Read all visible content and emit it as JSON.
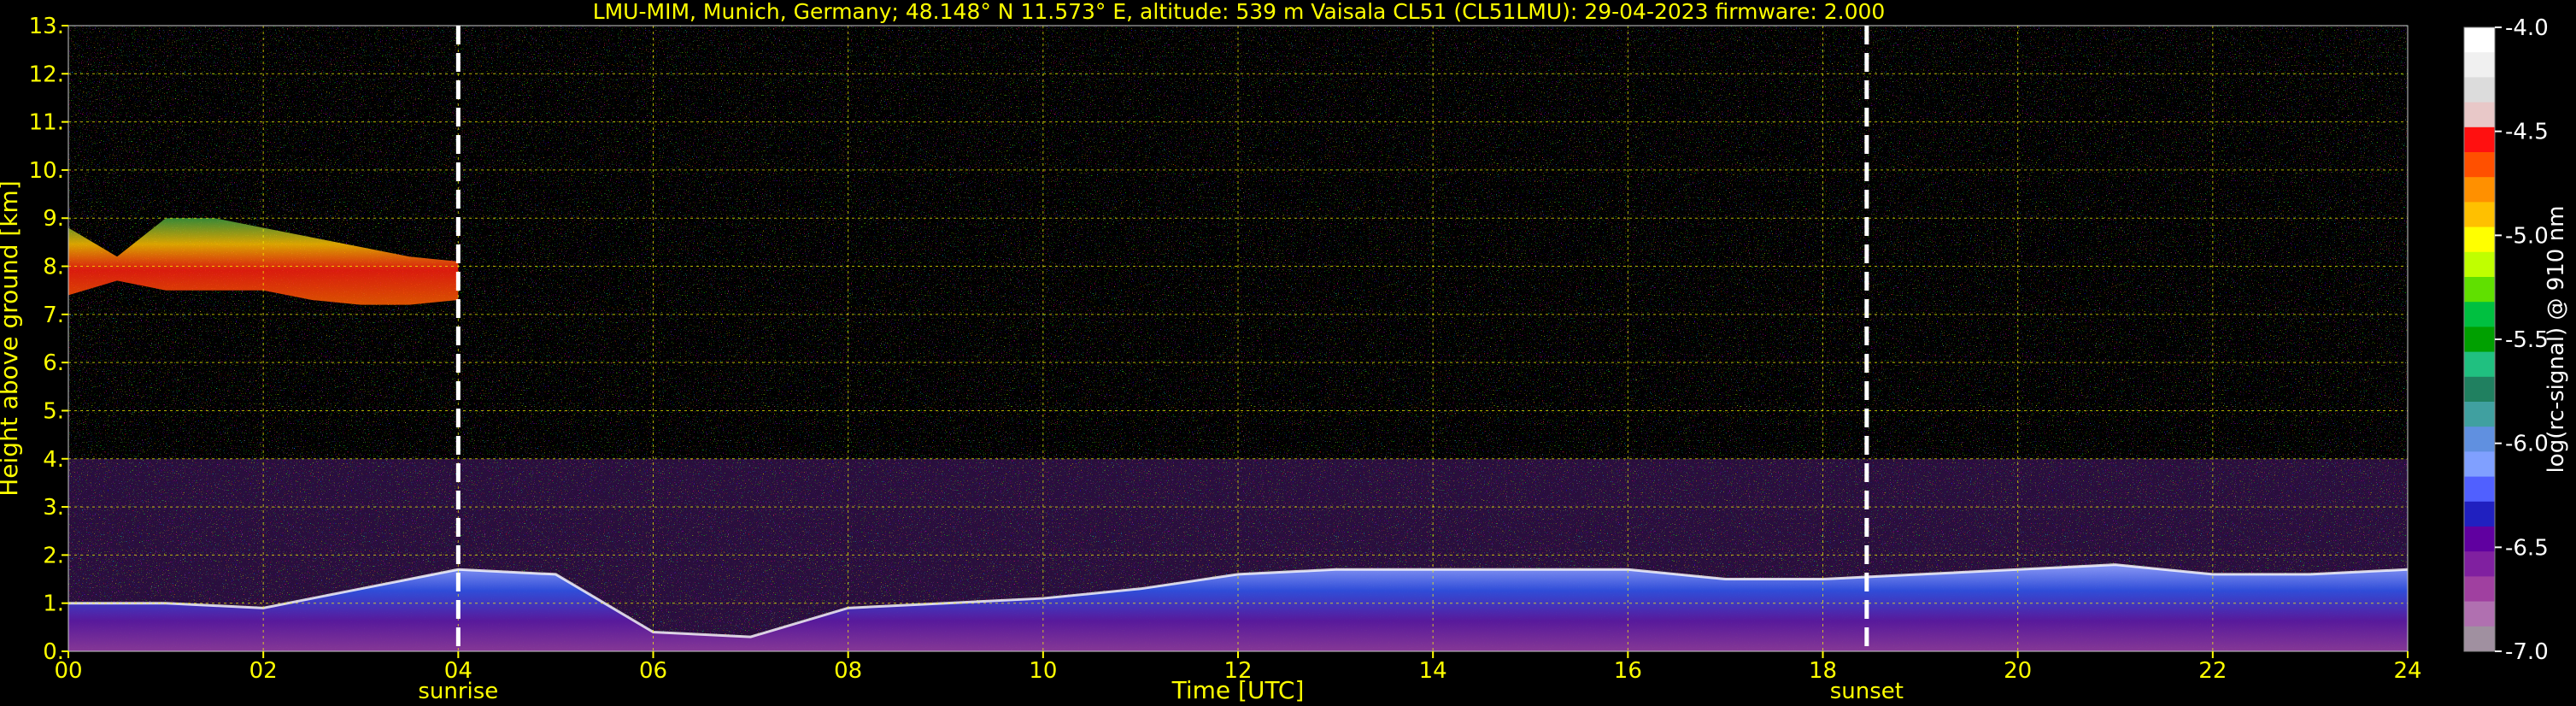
{
  "chart_data": {
    "type": "heatmap",
    "title": "LMU-MIM, Munich, Germany; 48.148° N 11.573° E, altitude: 539 m    Vaisala CL51 (CL51LMU): 29-04-2023    firmware: 2.000",
    "xlabel": "Time [UTC]",
    "ylabel": "Height above ground [km]",
    "xlim": [
      0,
      24
    ],
    "ylim": [
      0,
      13
    ],
    "x_ticks": [
      "00",
      "02",
      "04",
      "06",
      "08",
      "10",
      "12",
      "14",
      "16",
      "18",
      "20",
      "22",
      "24"
    ],
    "x_tick_values": [
      0,
      2,
      4,
      6,
      8,
      10,
      12,
      14,
      16,
      18,
      20,
      22,
      24
    ],
    "y_ticks": [
      "0.",
      "1.",
      "2.",
      "3.",
      "4.",
      "5.",
      "6.",
      "7.",
      "8.",
      "9.",
      "10.",
      "11.",
      "12.",
      "13."
    ],
    "y_tick_values": [
      0,
      1,
      2,
      3,
      4,
      5,
      6,
      7,
      8,
      9,
      10,
      11,
      12,
      13
    ],
    "grid": true,
    "events": [
      {
        "label": "sunrise",
        "time": 4.0
      },
      {
        "label": "sunset",
        "time": 18.45
      }
    ],
    "colorbar": {
      "label": "log(rc-signal) @ 910 nm",
      "range": [
        -7.0,
        -4.0
      ],
      "ticks": [
        "-4.0",
        "-4.5",
        "-5.0",
        "-5.5",
        "-6.0",
        "-6.5",
        "-7.0"
      ],
      "tick_values": [
        -4.0,
        -4.5,
        -5.0,
        -5.5,
        -6.0,
        -6.5,
        -7.0
      ],
      "colors": [
        "#ffffff",
        "#f0f0f0",
        "#dcdcdc",
        "#e8c8c8",
        "#ff1010",
        "#ff5000",
        "#ff9000",
        "#ffc000",
        "#ffff00",
        "#c0ff00",
        "#60e000",
        "#00c040",
        "#00a000",
        "#20c080",
        "#208060",
        "#40a0a0",
        "#6090e0",
        "#80a0ff",
        "#5060ff",
        "#2020c0",
        "#6000a0",
        "#8020a0",
        "#a040a0",
        "#b070b0",
        "#a090a0"
      ]
    },
    "layers": [
      {
        "name": "boundary layer",
        "x": [
          0,
          1,
          2,
          3,
          4,
          5,
          6,
          7,
          8,
          9,
          10,
          11,
          12,
          13,
          14,
          15,
          16,
          17,
          18,
          19,
          20,
          21,
          22,
          23,
          24
        ],
        "top": [
          1.0,
          1.0,
          0.9,
          1.3,
          1.7,
          1.6,
          0.4,
          0.3,
          0.9,
          1.0,
          1.1,
          1.3,
          1.6,
          1.7,
          1.7,
          1.7,
          1.7,
          1.5,
          1.5,
          1.6,
          1.7,
          1.8,
          1.6,
          1.6,
          1.7
        ]
      },
      {
        "name": "cirrus",
        "x": [
          0.0,
          0.5,
          1.0,
          1.5,
          2.0,
          2.5,
          3.0,
          3.5,
          4.0
        ],
        "base": [
          7.4,
          7.7,
          7.5,
          7.5,
          7.5,
          7.3,
          7.2,
          7.2,
          7.3
        ],
        "top": [
          8.8,
          8.2,
          9.0,
          9.0,
          8.8,
          8.6,
          8.4,
          8.2,
          8.1
        ]
      }
    ]
  }
}
